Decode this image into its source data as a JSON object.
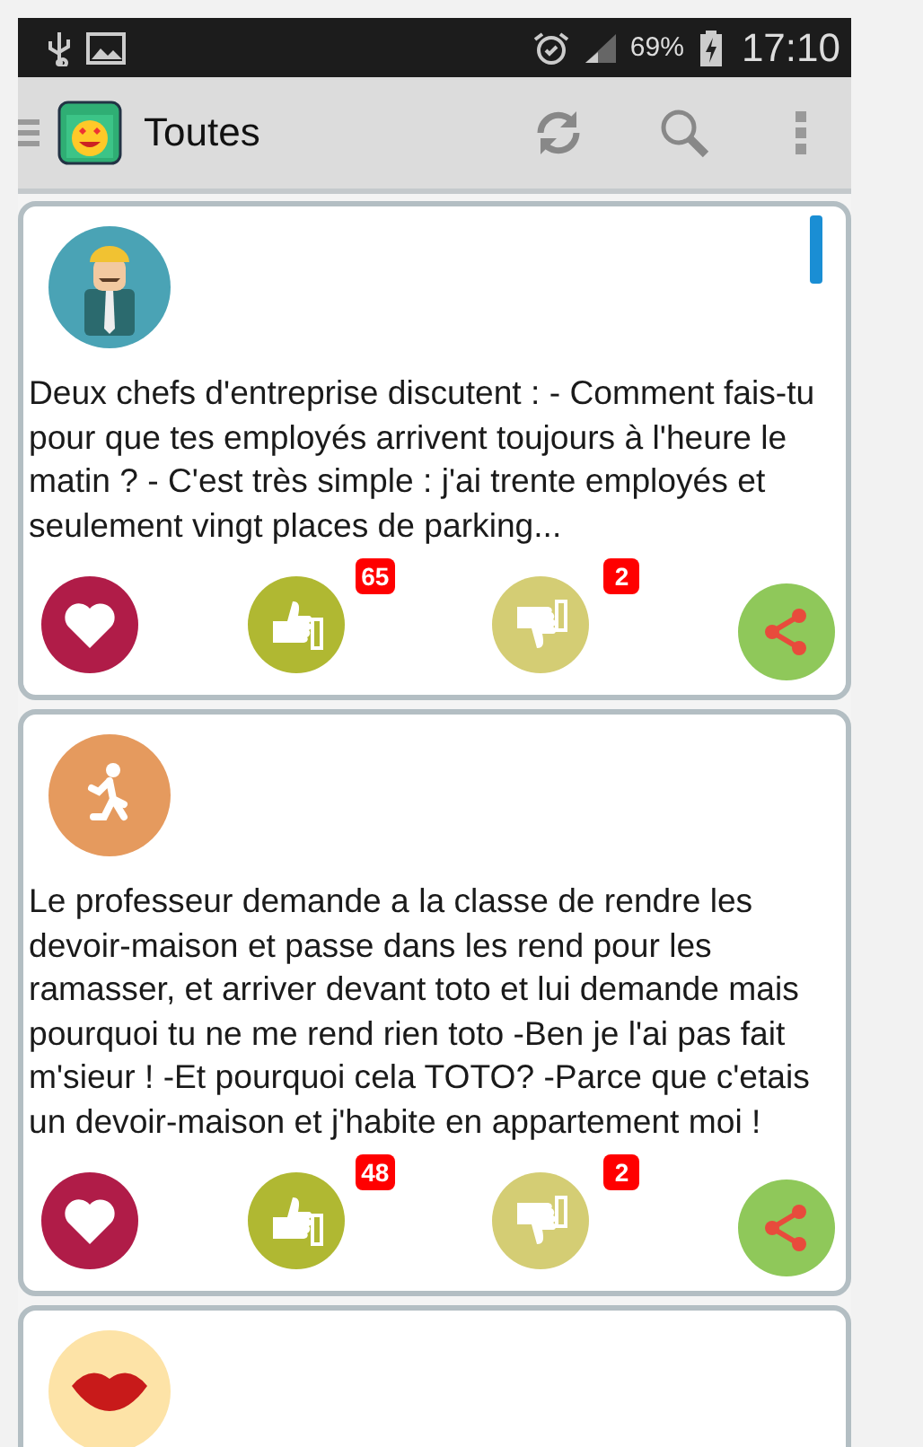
{
  "status_bar": {
    "battery": "69%",
    "time": "17:10"
  },
  "toolbar": {
    "title": "Toutes"
  },
  "posts": [
    {
      "avatar": {
        "kind": "worker",
        "color": "#4aa3b5"
      },
      "text": "Deux chefs d'entreprise discutent : - Comment fais-tu pour que tes employés arrivent toujours à l'heure le matin ? - C'est très simple : j'ai trente employés et seulement vingt places de parking...",
      "likes": "65",
      "dislikes": "2"
    },
    {
      "avatar": {
        "kind": "runner",
        "color": "#e59a5e"
      },
      "text": "Le professeur demande a la classe de rendre les devoir-maison et passe dans les rend pour les ramasser, et arriver devant toto et lui demande mais pourquoi tu ne me rend rien toto -Ben je l'ai pas fait m'sieur ! -Et pourquoi cela TOTO? -Parce que c'etais un devoir-maison et j'habite en appartement moi !",
      "likes": "48",
      "dislikes": "2"
    },
    {
      "avatar": {
        "kind": "lips",
        "color": "#fde3a7"
      }
    }
  ]
}
